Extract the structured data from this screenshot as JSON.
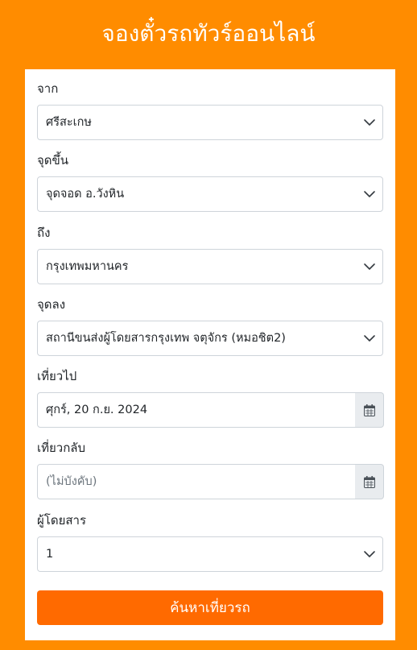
{
  "header": {
    "title": "จองตั๋วรถทัวร์ออนไลน์"
  },
  "form": {
    "from": {
      "label": "จาก",
      "value": "ศรีสะเกษ"
    },
    "pickup": {
      "label": "จุดขึ้น",
      "value": "จุดจอด อ.วังหิน"
    },
    "to": {
      "label": "ถึง",
      "value": "กรุงเทพมหานคร"
    },
    "dropoff": {
      "label": "จุดลง",
      "value": "สถานีขนส่งผู้โดยสารกรุงเทพ จตุจักร (หมอชิต2)"
    },
    "depart": {
      "label": "เที่ยวไป",
      "value": "ศุกร์, 20 ก.ย. 2024"
    },
    "return": {
      "label": "เที่ยวกลับ",
      "placeholder": "(ไม่บังคับ)"
    },
    "passengers": {
      "label": "ผู้โดยสาร",
      "value": "1"
    },
    "submit_label": "ค้นหาเที่ยวรถ"
  },
  "icons": {
    "select_arrow": "chevron-down-icon",
    "date_picker": "calendar-icon"
  },
  "colors": {
    "background": "#ff8c00",
    "button": "#ff6a00",
    "card": "#ffffff",
    "addon": "#e9ecef"
  }
}
